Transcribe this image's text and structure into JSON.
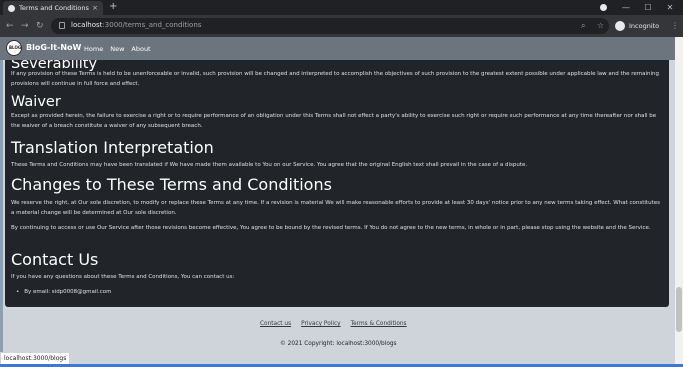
{
  "browser": {
    "tab_title": "Terms and Conditions",
    "tab_close": "×",
    "new_tab": "+",
    "back": "←",
    "forward": "→",
    "reload": "↻",
    "url_host": "localhost",
    "url_path": ":3000/terms_and_conditions",
    "profile_label": "Incognito",
    "window_min": "—",
    "window_max": "☐",
    "window_close": "✕",
    "zoom_icon": "⌕",
    "star_icon": "☆",
    "menu_icon": "⋮"
  },
  "site": {
    "logo_text": "BLOG",
    "brand": "BloG-It-NoW",
    "nav": [
      "Home",
      "New",
      "About"
    ]
  },
  "terms": {
    "severability_heading": "Severability",
    "severability_text": "If any provision of these Terms is held to be unenforceable or invalid, such provision will be changed and interpreted to accomplish the objectives of such provision to the greatest extent possible under applicable law and the remaining provisions will continue in full force and effect.",
    "waiver_heading": "Waiver",
    "waiver_text": "Except as provided herein, the failure to exercise a right or to require performance of an obligation under this Terms shall not effect a party's ability to exercise such right or require such performance at any time thereafter nor shall be the waiver of a breach constitute a waiver of any subsequent breach.",
    "translation_heading": "Translation Interpretation",
    "translation_text": "These Terms and Conditions may have been translated if We have made them available to You on our Service. You agree that the original English text shall prevail in the case of a dispute.",
    "changes_heading": "Changes to These Terms and Conditions",
    "changes_text_1": "We reserve the right, at Our sole discretion, to modify or replace these Terms at any time. If a revision is material We will make reasonable efforts to provide at least 30 days' notice prior to any new terms taking effect. What constitutes a material change will be determined at Our sole discretion.",
    "changes_text_2": "By continuing to access or use Our Service after those revisions become effective, You agree to be bound by the revised terms. If You do not agree to the new terms, in whole or in part, please stop using the website and the Service.",
    "contact_heading": "Contact Us",
    "contact_text": "If you have any questions about these Terms and Conditions, You can contact us:",
    "contact_email": "By email: sidp0008@gmail.com"
  },
  "footer": {
    "links": [
      "Contact us",
      "Privacy Policy",
      "Terms & Conditions"
    ],
    "copyright": "© 2021 Copyright: localhost:3000/blogs"
  },
  "status_url": "localhost:3000/blogs",
  "colors": {
    "navbar": "#6c757d",
    "card": "#212529",
    "page_bg": "#ced4da"
  }
}
